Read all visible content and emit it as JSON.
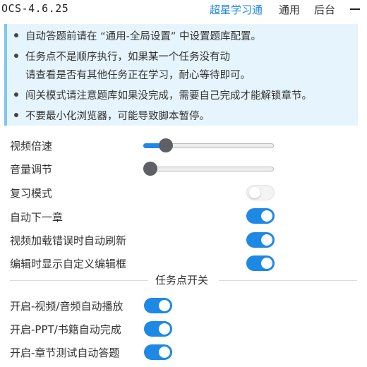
{
  "header": {
    "title": "OCS-4.6.25",
    "tabs": [
      {
        "label": "超星学习通",
        "active": true
      },
      {
        "label": "通用",
        "active": false
      },
      {
        "label": "后台",
        "active": false
      }
    ]
  },
  "notice": {
    "items": [
      "自动答题前请在 “通用-全局设置” 中设置题库配置。",
      "任务点不是顺序执行，如果某一个任务没有动",
      "请查看是否有其他任务正在学习，耐心等待即可。",
      "闯关模式请注意题库如果没完成，需要自己完成才能解锁章节。",
      "不要最小化浏览器，可能导致脚本暂停。"
    ]
  },
  "settings": {
    "playback_rate": {
      "label": "视频倍速",
      "value_fraction": 0.12
    },
    "volume": {
      "label": "音量调节",
      "value_fraction": 0.0
    },
    "review_mode": {
      "label": "复习模式",
      "on": false
    },
    "auto_next": {
      "label": "自动下一章",
      "on": true
    },
    "auto_refresh": {
      "label": "视频加载错误时自动刷新",
      "on": true
    },
    "custom_editor": {
      "label": "编辑时显示自定义编辑框",
      "on": true
    }
  },
  "task_switch": {
    "heading": "任务点开关",
    "video_audio": {
      "label": "开启-视频/音频自动播放",
      "on": true
    },
    "ppt_book": {
      "label": "开启-PPT/书籍自动完成",
      "on": true
    },
    "chapter_test": {
      "label": "开启-章节测试自动答题",
      "on": true
    }
  },
  "colors": {
    "accent": "#1e88e5",
    "notice_bg": "#e6f4fd",
    "notice_border": "#7fc6f4"
  }
}
